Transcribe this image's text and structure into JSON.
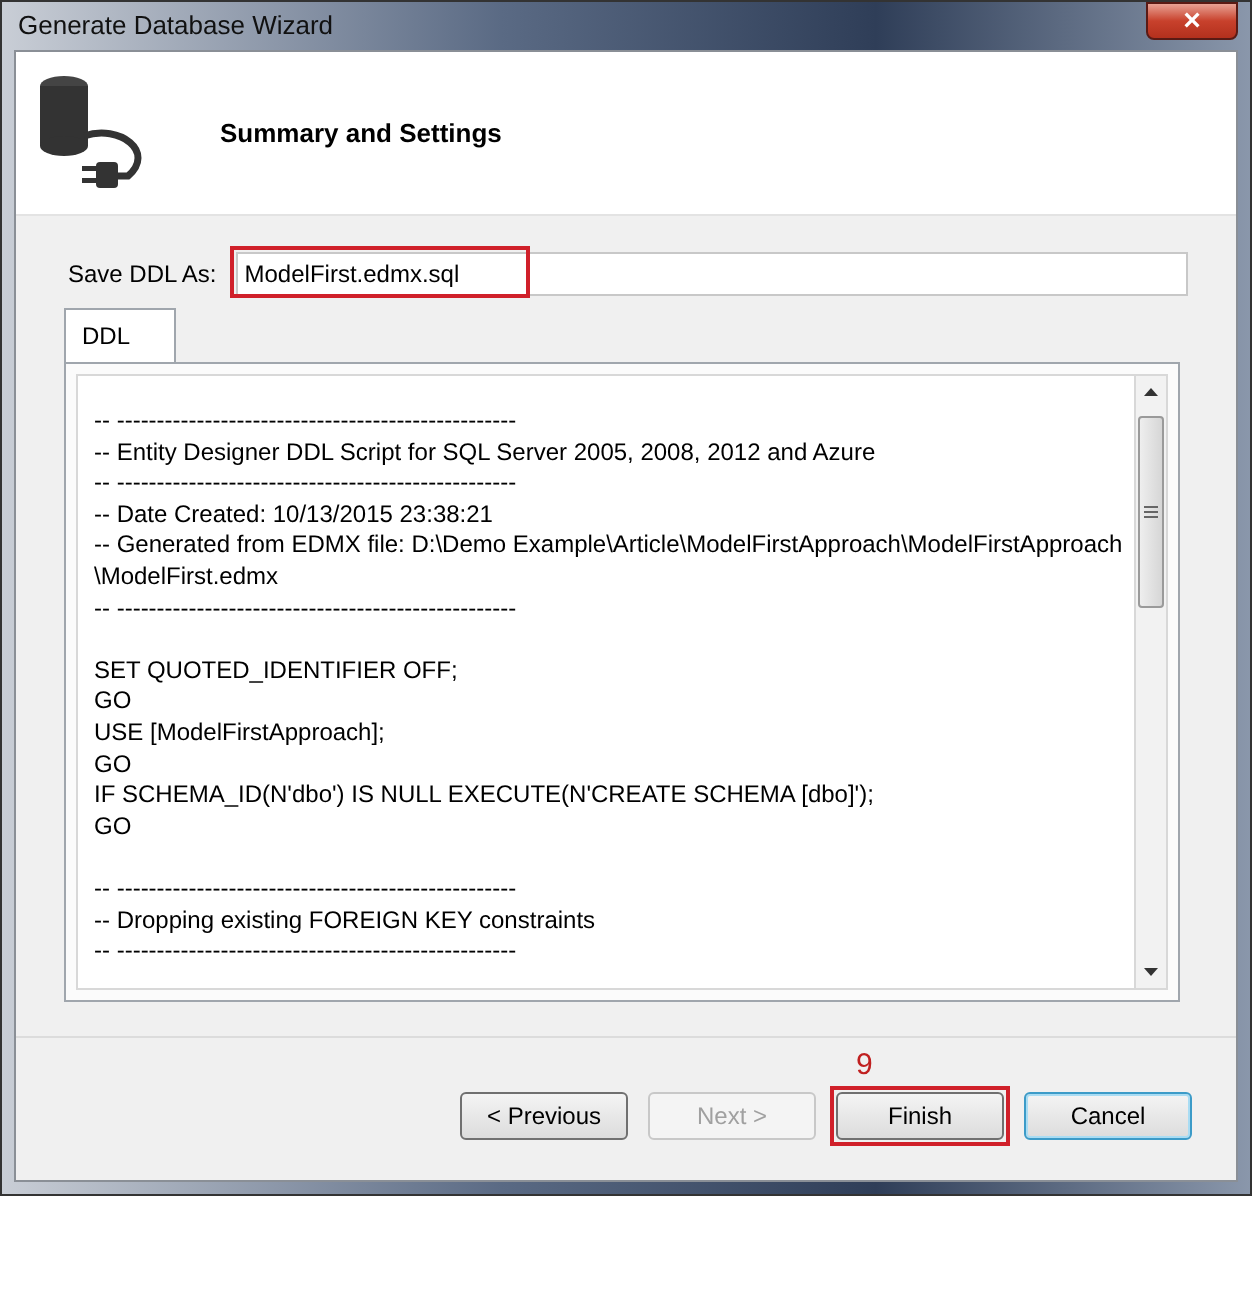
{
  "window": {
    "title": "Generate Database Wizard",
    "close": "×"
  },
  "header": {
    "title": "Summary and Settings"
  },
  "save_field": {
    "label": "Save DDL As:",
    "value": "ModelFirst.edmx.sql",
    "highlighted": true
  },
  "tabs": [
    {
      "label": "DDL",
      "selected": true
    }
  ],
  "ddl_blocks": [
    [
      "-- --------------------------------------------------",
      "-- Entity Designer DDL Script for SQL Server 2005, 2008, 2012 and Azure",
      "-- --------------------------------------------------",
      "-- Date Created: 10/13/2015 23:38:21",
      "-- Generated from EDMX file: D:\\Demo Example\\Article\\ModelFirstApproach\\ModelFirstApproach",
      "\\ModelFirst.edmx",
      "-- --------------------------------------------------"
    ],
    [
      "SET QUOTED_IDENTIFIER OFF;",
      "GO",
      "USE [ModelFirstApproach];",
      "GO",
      "IF SCHEMA_ID(N'dbo') IS NULL EXECUTE(N'CREATE SCHEMA [dbo]');",
      "GO"
    ],
    [
      "-- --------------------------------------------------",
      "-- Dropping existing FOREIGN KEY constraints",
      "-- --------------------------------------------------"
    ]
  ],
  "annotation": "9",
  "buttons": [
    {
      "label": "< Previous",
      "disabled": false,
      "highlighted": false,
      "focused": false
    },
    {
      "label": "Next >",
      "disabled": true,
      "highlighted": false,
      "focused": false
    },
    {
      "label": "Finish",
      "disabled": false,
      "highlighted": true,
      "focused": false
    },
    {
      "label": "Cancel",
      "disabled": false,
      "highlighted": false,
      "focused": true
    }
  ]
}
